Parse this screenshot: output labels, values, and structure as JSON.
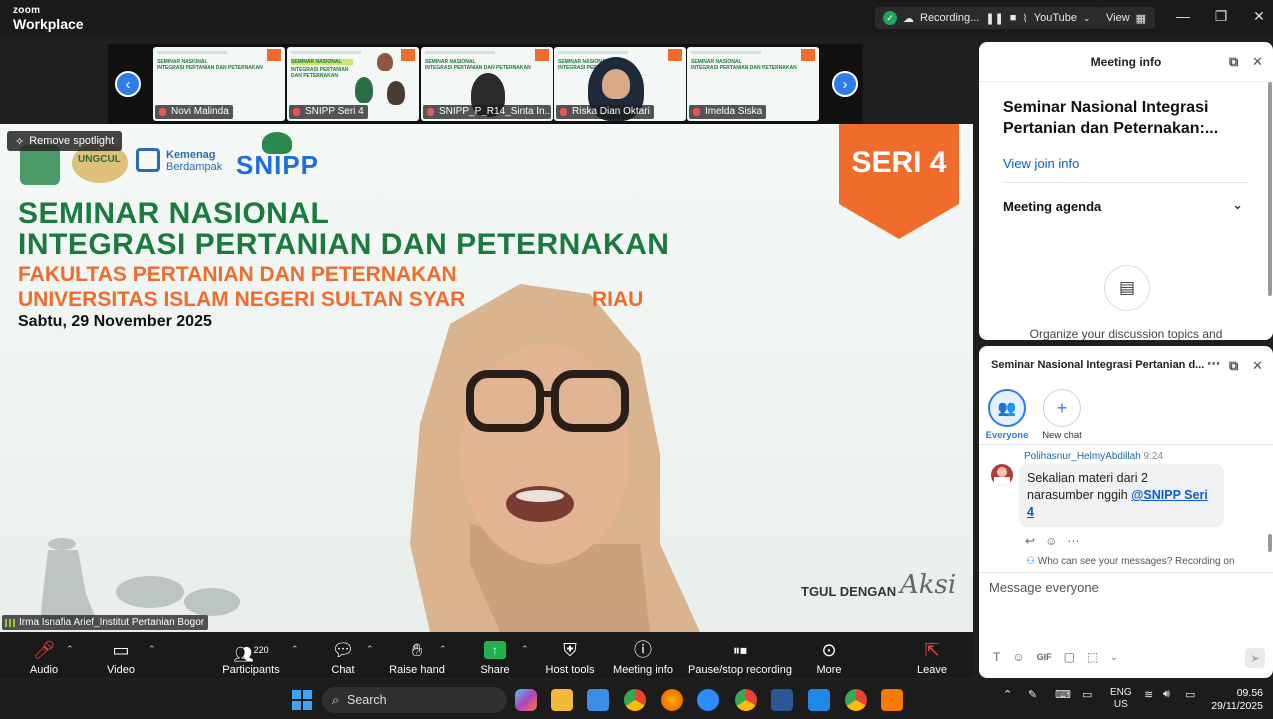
{
  "app": {
    "logo_line1": "zoom",
    "logo_line2": "Workplace"
  },
  "titlebar": {
    "recording_label": "Recording...",
    "youtube_label": "YouTube",
    "view_label": "View"
  },
  "thumbnails": [
    {
      "name": "Novi Malinda"
    },
    {
      "name": "SNIPP Seri 4"
    },
    {
      "name": "SNIPP_P_R14_Sinta In..."
    },
    {
      "name": "Riska Dian Oktari"
    },
    {
      "name": "Imelda Siska"
    }
  ],
  "main": {
    "remove_spotlight": "Remove spotlight",
    "logo_ungcul": "UNGCUL",
    "logo_kemenag_1": "Kemenag",
    "logo_kemenag_2": "Berdampak",
    "logo_snipp": "SNIPP",
    "title_line1": "SEMINAR NASIONAL",
    "title_line2": "INTEGRASI PERTANIAN DAN PETERNAKAN",
    "subtitle_line1": "FAKULTAS PERTANIAN DAN PETERNAKAN",
    "subtitle_line2": "UNIVERSITAS ISLAM NEGERI SULTAN SYAR",
    "subtitle_line2_end": "RIAU",
    "date": "Sabtu, 29 November 2025",
    "seri": "SERI 4",
    "tagline": "TGUL DENGAN",
    "aksi": "Aksi",
    "speaker_name": "Irma Isnafia Arief_Institut Pertanian Bogor"
  },
  "info_panel": {
    "header": "Meeting info",
    "title": "Seminar Nasional Integrasi Pertanian dan Peternakan:...",
    "join_link": "View join info",
    "agenda_label": "Meeting agenda",
    "organize_text": "Organize your discussion topics and"
  },
  "chat_panel": {
    "header": "Seminar Nasional Integrasi Pertanian d...",
    "everyone_label": "Everyone",
    "new_chat_label": "New chat",
    "sender": "Polihasnur_HelmyAbdillah",
    "time": "9:24",
    "message_text": "Sekalian materi dari 2 narasumber nggih ",
    "message_mention": "@SNIPP Seri 4",
    "who_can_see": "Who can see your messages? Recording on",
    "input_placeholder": "Message everyone"
  },
  "toolbar": {
    "audio": "Audio",
    "video": "Video",
    "participants": "Participants",
    "participants_count": "220",
    "chat": "Chat",
    "raise_hand": "Raise hand",
    "share": "Share",
    "host_tools": "Host tools",
    "meeting_info": "Meeting info",
    "pause_recording": "Pause/stop recording",
    "more": "More",
    "leave": "Leave"
  },
  "taskbar": {
    "search": "Search",
    "lang1": "ENG",
    "lang2": "US",
    "time": "09.56",
    "date": "29/11/2025"
  },
  "colors": {
    "zoom_blue": "#2f7be9",
    "green_title": "#1b7a3e",
    "orange": "#ef6c2c",
    "share_green": "#23b14d"
  }
}
